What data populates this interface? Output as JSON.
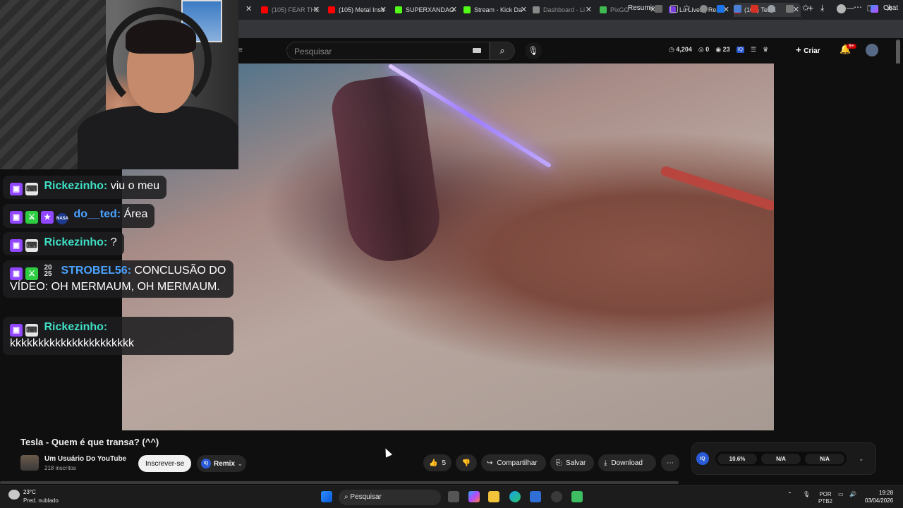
{
  "browser": {
    "tabs": [
      {
        "label": "(105) FEAR THE",
        "color": "#ff0000",
        "dim": true
      },
      {
        "label": "(105) Metal Instr",
        "color": "#ff0000",
        "dim": false
      },
      {
        "label": "SUPERXANDAO",
        "color": "#53fc18",
        "dim": false
      },
      {
        "label": "Stream - Kick Da",
        "color": "#53fc18",
        "dim": false
      },
      {
        "label": "Dashboard - Li",
        "color": "#888888",
        "dim": true
      },
      {
        "label": "PixGG",
        "color": "#3fb950",
        "dim": true
      },
      {
        "label": "Lu Lives | React",
        "color": "#7b3fe4",
        "dim": false
      },
      {
        "label": "(105) Tesla",
        "color": "#ff0000",
        "dim": false
      }
    ],
    "resume_label": "Resumir",
    "chat_label": "Chat"
  },
  "youtube": {
    "search_placeholder": "Pesquisar",
    "stats": {
      "views": "4,204",
      "eye": "0",
      "watchers": "23"
    },
    "create_label": "Criar",
    "notif_count": "9+"
  },
  "chat": {
    "messages": [
      {
        "nick": "Rickezinho:",
        "nick_color": "#3fe0c5",
        "text": "viu o meu"
      },
      {
        "nick": "do__ted:",
        "nick_color": "#4aa3ff",
        "text": "Área"
      },
      {
        "nick": "Rickezinho:",
        "nick_color": "#3fe0c5",
        "text": "?"
      },
      {
        "nick": "STROBEL56:",
        "nick_color": "#4aa3ff",
        "text": "CONCLUSÃO DO VÍDEO: OH MERMAUM, OH MERMAUM."
      },
      {
        "nick": "Rickezinho:",
        "nick_color": "#3fe0c5",
        "text": "kkkkkkkkkkkkkkkkkkkkkk"
      }
    ],
    "year_badge": "20 25"
  },
  "video": {
    "title": "Tesla - Quem é que transa? (^^)",
    "channel": "Um Usuário Do YouTube",
    "subscribers": "218 inscritos",
    "subscribe_label": "Inscrever-se",
    "remix_label": "Remix",
    "likes": "5",
    "share_label": "Compartilhar",
    "save_label": "Salvar",
    "download_label": "Download",
    "iq": {
      "logo": "IQ",
      "v1": "10.6%",
      "v2": "N/A",
      "v3": "N/A"
    }
  },
  "taskbar": {
    "temp": "23°C",
    "weather": "Pred. nublado",
    "search_label": "Pesquisar",
    "lang_line1": "POR",
    "lang_line2": "PTB2",
    "time": "19:28",
    "date": "03/04/2026"
  }
}
